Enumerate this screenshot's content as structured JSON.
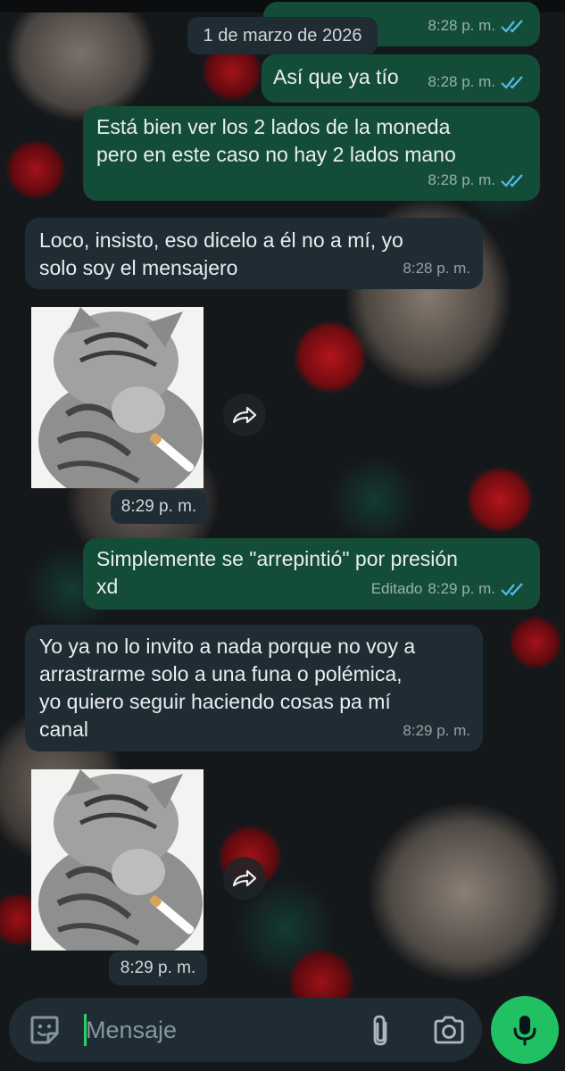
{
  "date_divider": "1 de marzo de 2026",
  "colors": {
    "outgoing_bubble": "#144d37",
    "incoming_bubble": "#1f2c33",
    "read_ticks": "#53bdeb",
    "mic_button": "#21c063",
    "cursor": "#25d366"
  },
  "messages": [
    {
      "direction": "out",
      "text": "Así que ya tío",
      "time": "8:28 p. m.",
      "status": "read"
    },
    {
      "direction": "out",
      "text": "Está bien ver los 2 lados de la moneda\npero en este caso no hay 2 lados mano",
      "time": "8:28 p. m.",
      "status": "read"
    },
    {
      "direction": "in",
      "text": "Loco, insisto, eso dicelo a él no a mí, yo\nsolo soy el mensajero",
      "time": "8:28 p. m."
    },
    {
      "direction": "in",
      "type": "sticker",
      "sticker": "cat-smoking-sticker",
      "time": "8:29 p. m."
    },
    {
      "direction": "out",
      "text": "Simplemente se \"arrepintió\" por presión\nxd",
      "edited_label": "Editado",
      "time": "8:29 p. m.",
      "status": "read"
    },
    {
      "direction": "in",
      "text": "Yo ya no lo invito a nada porque no voy a\narrastrarme solo a una funa o polémica,\nyo quiero seguir haciendo cosas pa mí\ncanal",
      "time": "8:29 p. m."
    },
    {
      "direction": "in",
      "type": "sticker",
      "sticker": "cat-smoking-sticker",
      "time": "8:29 p. m."
    }
  ],
  "composer": {
    "placeholder": "Mensaje",
    "emoji_icon": "sticker-icon",
    "attach_icon": "paperclip-icon",
    "camera_icon": "camera-icon",
    "send_icon": "microphone-icon"
  }
}
